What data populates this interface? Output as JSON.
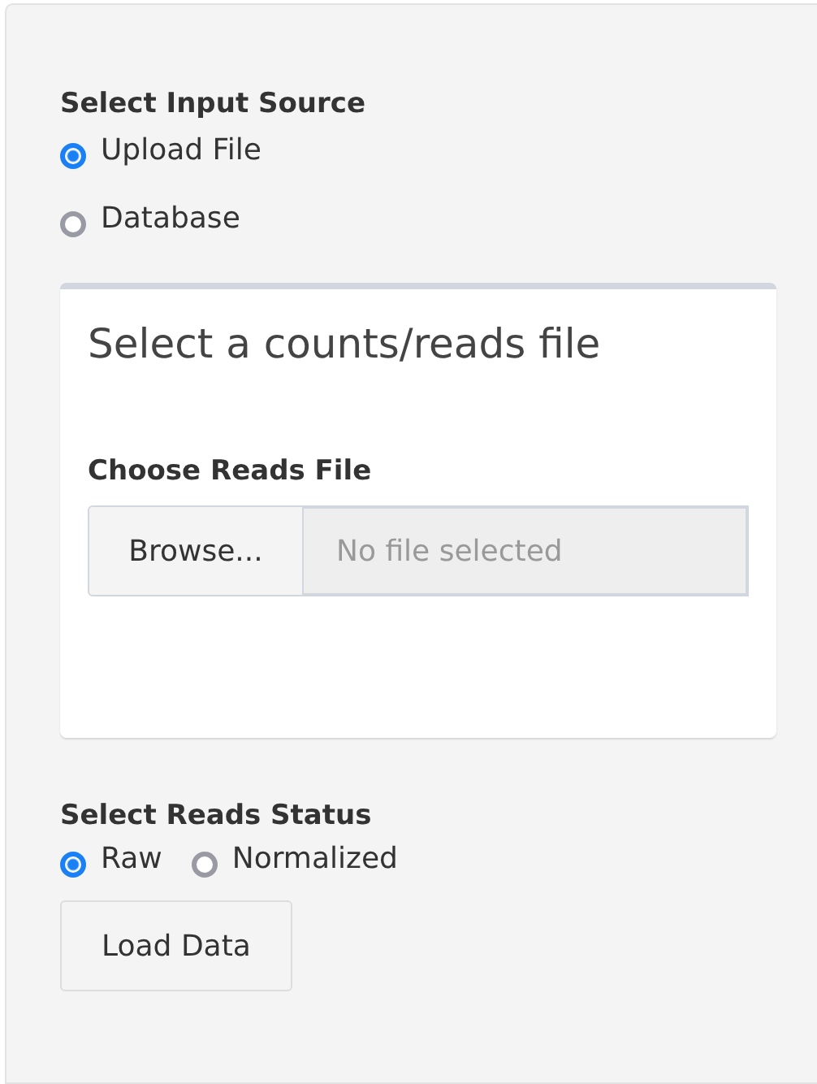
{
  "input_source": {
    "label": "Select Input Source",
    "options": [
      {
        "label": "Upload File",
        "selected": true
      },
      {
        "label": "Database",
        "selected": false
      }
    ]
  },
  "upload_box": {
    "title": "Select a counts/reads file",
    "file_input": {
      "label": "Choose Reads File",
      "button": "Browse...",
      "placeholder": "No file selected"
    }
  },
  "reads_status": {
    "label": "Select Reads Status",
    "options": [
      {
        "label": "Raw",
        "selected": true
      },
      {
        "label": "Normalized",
        "selected": false
      }
    ]
  },
  "load_button": "Load Data"
}
